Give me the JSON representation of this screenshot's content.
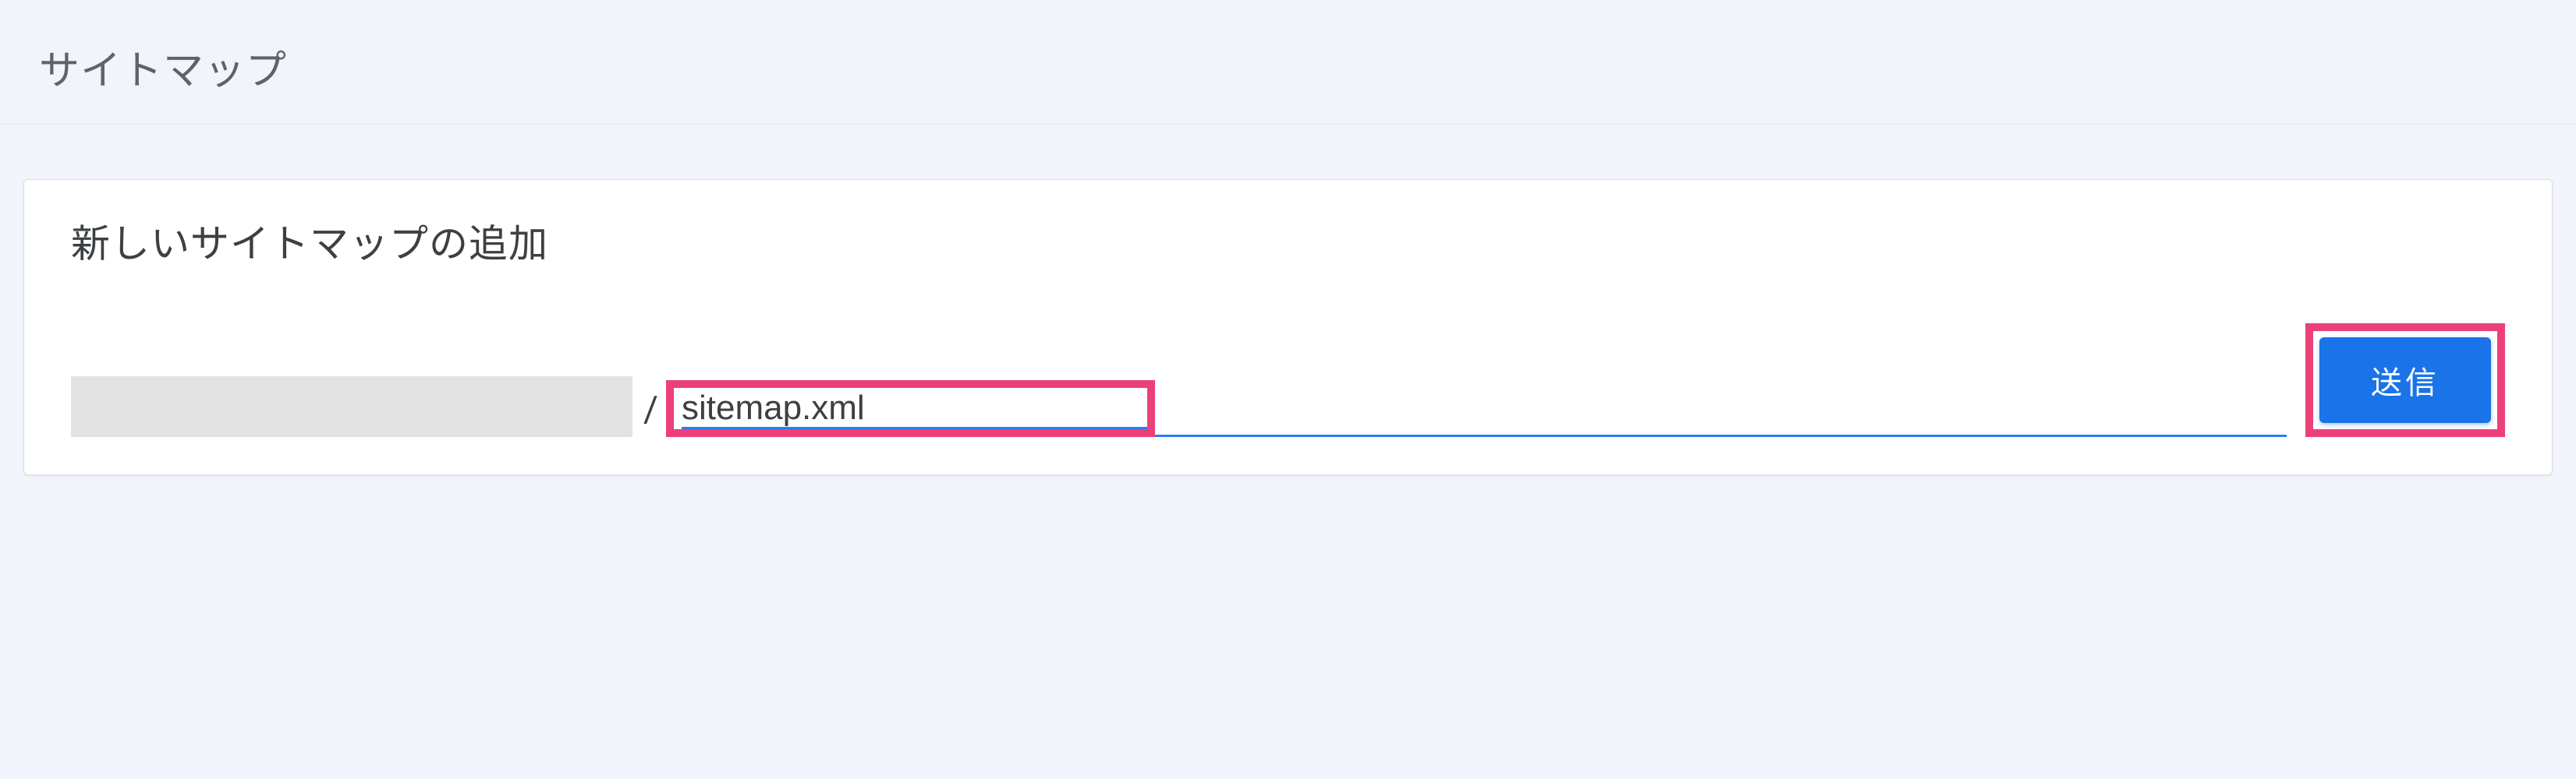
{
  "header": {
    "title": "サイトマップ"
  },
  "card": {
    "title": "新しいサイトマップの追加",
    "slash": "/",
    "input_value": "sitemap.xml",
    "submit_label": "送信"
  }
}
